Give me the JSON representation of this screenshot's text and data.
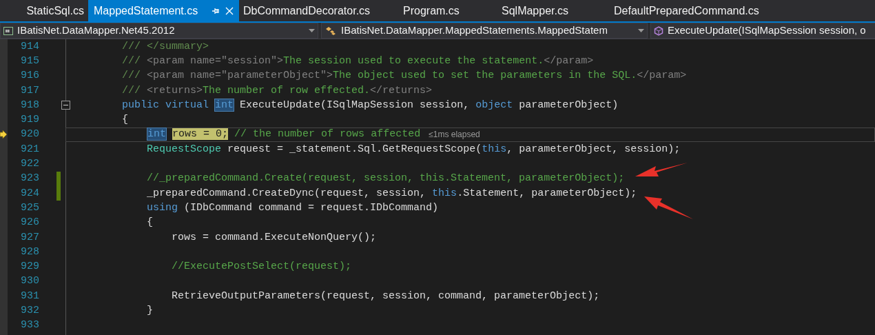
{
  "tabs": [
    {
      "label": "StaticSql.cs",
      "selected": false
    },
    {
      "label": "MappedStatement.cs",
      "selected": true
    },
    {
      "label": "DbCommandDecorator.cs",
      "selected": false
    },
    {
      "label": "Program.cs",
      "selected": false
    },
    {
      "label": "SqlMapper.cs",
      "selected": false
    },
    {
      "label": "DefaultPreparedCommand.cs",
      "selected": false
    }
  ],
  "navigation_bar": {
    "project": "IBatisNet.DataMapper.Net45.2012",
    "type": "IBatisNet.DataMapper.MappedStatements.MappedStatem",
    "member": "ExecuteUpdate(ISqlMapSession session, o"
  },
  "editor": {
    "lines": [
      {
        "number": "914",
        "current": false,
        "changed": false,
        "collapsible": false,
        "tokens": [
          {
            "text": "        /// </summary>",
            "kind": "doc"
          }
        ]
      },
      {
        "number": "915",
        "current": false,
        "changed": false,
        "collapsible": false,
        "tokens": [
          {
            "text": "        ///",
            "kind": "doc"
          },
          {
            "text": " <param name=\"session\">",
            "kind": "doctag"
          },
          {
            "text": "The session used to execute the statement.",
            "kind": "comment"
          },
          {
            "text": "</param>",
            "kind": "doctag"
          }
        ]
      },
      {
        "number": "916",
        "current": false,
        "changed": false,
        "collapsible": false,
        "tokens": [
          {
            "text": "        ///",
            "kind": "doc"
          },
          {
            "text": " <param name=\"parameterObject\">",
            "kind": "doctag"
          },
          {
            "text": "The object used to set the parameters in the SQL.",
            "kind": "comment"
          },
          {
            "text": "</param>",
            "kind": "doctag"
          }
        ]
      },
      {
        "number": "917",
        "current": false,
        "changed": false,
        "collapsible": false,
        "tokens": [
          {
            "text": "        ///",
            "kind": "doc"
          },
          {
            "text": " <returns>",
            "kind": "doctag"
          },
          {
            "text": "The number of row effected.",
            "kind": "comment"
          },
          {
            "text": "</returns>",
            "kind": "doctag"
          }
        ]
      },
      {
        "number": "918",
        "current": false,
        "changed": false,
        "collapsible": true,
        "tokens": [
          {
            "text": "        public virtual ",
            "kind": "keyword"
          },
          {
            "text": "int",
            "kind": "selection"
          },
          {
            "text": " ExecuteUpdate(ISqlMapSession session, ",
            "kind": "plain"
          },
          {
            "text": "object",
            "kind": "keyword"
          },
          {
            "text": " parameterObject)",
            "kind": "plain"
          }
        ]
      },
      {
        "number": "919",
        "current": false,
        "changed": false,
        "collapsible": false,
        "tokens": [
          {
            "text": "        {",
            "kind": "plain"
          }
        ]
      },
      {
        "number": "920",
        "current": true,
        "changed": false,
        "collapsible": false,
        "tokens": [
          {
            "text": "            int",
            "kind": "selection"
          },
          {
            "text": " rows = 0;",
            "kind": "statement"
          },
          {
            "text": " // the number of rows affected",
            "kind": "comment"
          }
        ],
        "perf_tip": "≤1ms elapsed"
      },
      {
        "number": "921",
        "current": false,
        "changed": false,
        "collapsible": false,
        "tokens": [
          {
            "text": "            RequestScope",
            "kind": "type"
          },
          {
            "text": " request = _statement.Sql.GetRequestScope(",
            "kind": "plain"
          },
          {
            "text": "this",
            "kind": "keyword"
          },
          {
            "text": ", parameterObject, session);",
            "kind": "plain"
          }
        ]
      },
      {
        "number": "922",
        "current": false,
        "changed": false,
        "collapsible": false
      },
      {
        "number": "923",
        "current": false,
        "changed": true,
        "collapsible": false,
        "tokens": [
          {
            "text": "            //_preparedCommand.Create(request, session, this.Statement, parameterObject);",
            "kind": "comment"
          }
        ]
      },
      {
        "number": "924",
        "current": false,
        "changed": true,
        "collapsible": false,
        "tokens": [
          {
            "text": "            _preparedCommand.CreateDync(request, session, ",
            "kind": "plain"
          },
          {
            "text": "this",
            "kind": "keyword"
          },
          {
            "text": ".Statement, parameterObject);",
            "kind": "plain"
          }
        ]
      },
      {
        "number": "925",
        "current": false,
        "changed": false,
        "collapsible": false,
        "tokens": [
          {
            "text": "            using",
            "kind": "keyword"
          },
          {
            "text": " (IDbCommand command = request.IDbCommand)",
            "kind": "plain"
          }
        ]
      },
      {
        "number": "926",
        "current": false,
        "changed": false,
        "collapsible": false,
        "tokens": [
          {
            "text": "            {",
            "kind": "plain"
          }
        ]
      },
      {
        "number": "927",
        "current": false,
        "changed": false,
        "collapsible": false,
        "tokens": [
          {
            "text": "                rows = command.ExecuteNonQuery();",
            "kind": "plain"
          }
        ]
      },
      {
        "number": "928",
        "current": false,
        "changed": false,
        "collapsible": false
      },
      {
        "number": "929",
        "current": false,
        "changed": false,
        "collapsible": false,
        "tokens": [
          {
            "text": "                //ExecutePostSelect(request);",
            "kind": "comment"
          }
        ]
      },
      {
        "number": "930",
        "current": false,
        "changed": false,
        "collapsible": false
      },
      {
        "number": "931",
        "current": false,
        "changed": false,
        "collapsible": false,
        "tokens": [
          {
            "text": "                RetrieveOutputParameters(request, session, command, parameterObject);",
            "kind": "plain"
          }
        ]
      },
      {
        "number": "932",
        "current": false,
        "changed": false,
        "collapsible": false,
        "tokens": [
          {
            "text": "            }",
            "kind": "plain"
          }
        ]
      },
      {
        "number": "933",
        "current": false,
        "changed": false,
        "collapsible": false
      }
    ]
  }
}
